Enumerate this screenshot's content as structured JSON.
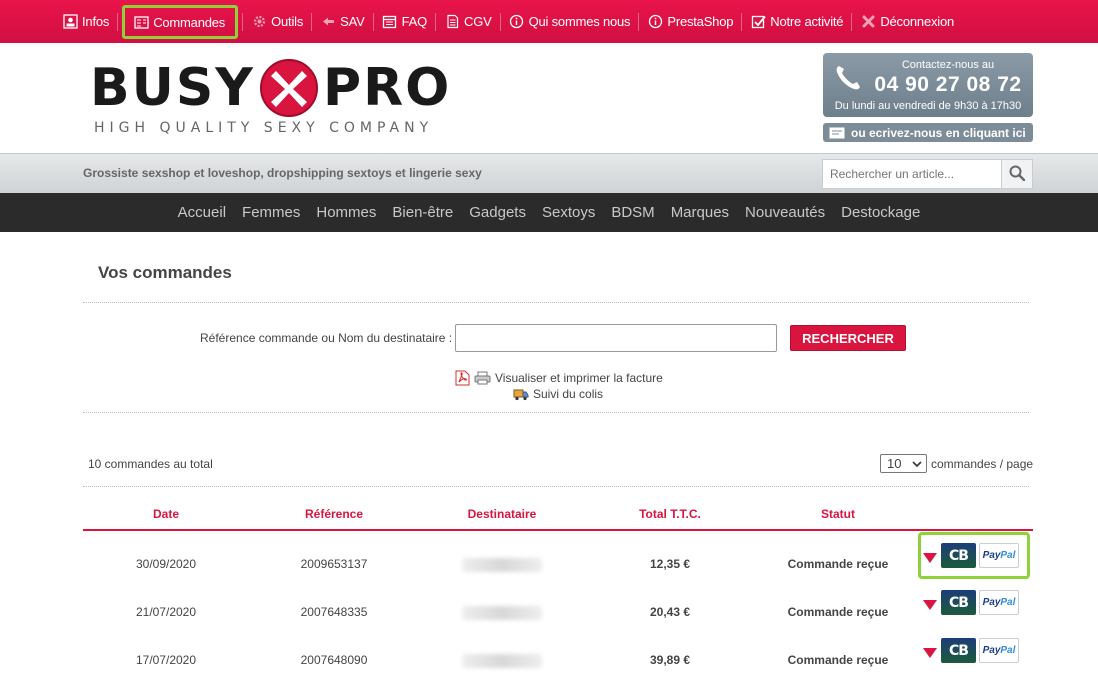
{
  "topnav": [
    {
      "label": "Infos",
      "icon": "user-card-icon"
    },
    {
      "label": "Commandes",
      "icon": "orders-icon"
    },
    {
      "label": "Outils",
      "icon": "gear-icon"
    },
    {
      "label": "SAV",
      "icon": "arrow-left-icon"
    },
    {
      "label": "FAQ",
      "icon": "calendar-icon"
    },
    {
      "label": "CGV",
      "icon": "document-icon"
    },
    {
      "label": "Qui sommes nous",
      "icon": "info-icon"
    },
    {
      "label": "PrestaShop",
      "icon": "info-icon"
    },
    {
      "label": "Notre activité",
      "icon": "checkbox-icon"
    },
    {
      "label": "Déconnexion",
      "icon": "close-icon"
    }
  ],
  "logo": {
    "part1": "BUSY",
    "part2": "PRO",
    "tagline": "HIGH QUALITY SEXY COMPANY"
  },
  "contact": {
    "label": "Contactez-nous au",
    "phone": "04 90 27 08 72",
    "hours": "Du lundi au vendredi de 9h30 à 17h30",
    "write_label": "ou ecrivez-nous en cliquant ici"
  },
  "band": {
    "tagline": "Grossiste sexshop et loveshop, dropshipping sextoys et lingerie sexy",
    "search_placeholder": "Rechercher un article..."
  },
  "mainnav": [
    "Accueil",
    "Femmes",
    "Hommes",
    "Bien-être",
    "Gadgets",
    "Sextoys",
    "BDSM",
    "Marques",
    "Nouveautés",
    "Destockage"
  ],
  "page": {
    "title": "Vos commandes",
    "search_label": "Référence commande ou Nom du destinataire :",
    "search_button": "RECHERCHER",
    "legend_invoice": "Visualiser et imprimer la facture",
    "legend_tracking": "Suivi du colis",
    "total_count": "10 commandes au total",
    "per_page_value": "10",
    "per_page_label": "commandes / page"
  },
  "table": {
    "headers": [
      "Date",
      "Référence",
      "Destinataire",
      "Total T.T.C.",
      "Statut"
    ],
    "rows": [
      {
        "date": "30/09/2020",
        "ref": "2009653137",
        "total": "12,35 €",
        "status": "Commande reçue"
      },
      {
        "date": "21/07/2020",
        "ref": "2007648335",
        "total": "20,43 €",
        "status": "Commande reçue"
      },
      {
        "date": "17/07/2020",
        "ref": "2007648090",
        "total": "39,89 €",
        "status": "Commande reçue"
      }
    ],
    "cb_label": "CB",
    "paypal_label_1": "Pay",
    "paypal_label_2": "Pal"
  },
  "colors": {
    "brand_red": "#d9143f",
    "highlight_green": "#8fd13a",
    "nav_dark": "#2b2b2b"
  }
}
